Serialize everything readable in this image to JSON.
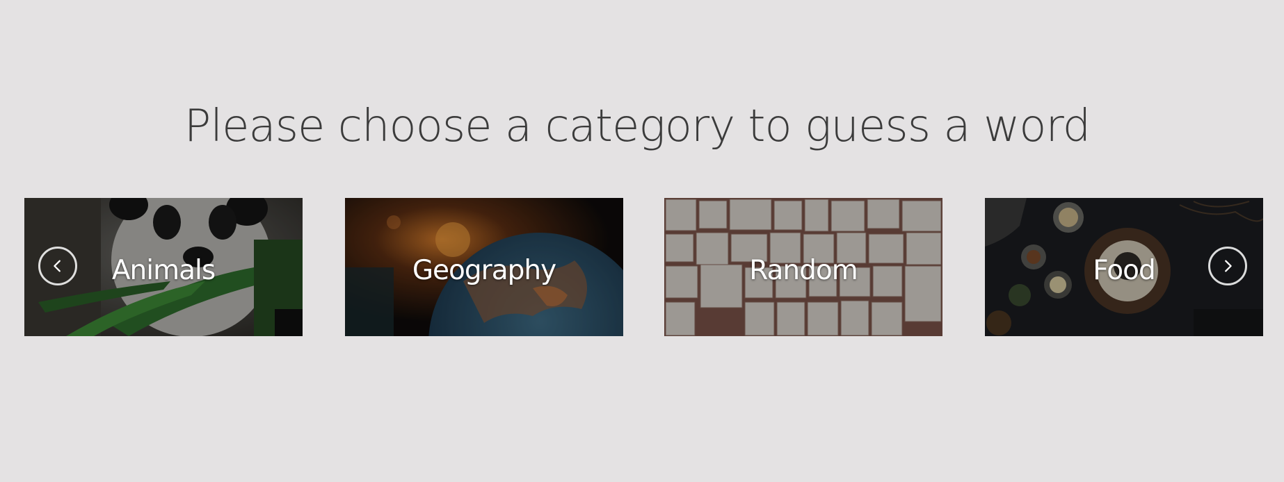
{
  "heading": "Please choose a category to guess a word",
  "categories": [
    {
      "label": "Animals",
      "image": "panda-eating-bamboo"
    },
    {
      "label": "Geography",
      "image": "globe"
    },
    {
      "label": "Random",
      "image": "book-pages"
    },
    {
      "label": "Food",
      "image": "food-bowls-on-dark-table"
    }
  ],
  "controls": {
    "prev_icon": "chevron-left-icon",
    "next_icon": "chevron-right-icon"
  },
  "colors": {
    "background": "#e4e2e3",
    "heading": "#3b3b3b",
    "label": "#ffffff"
  }
}
